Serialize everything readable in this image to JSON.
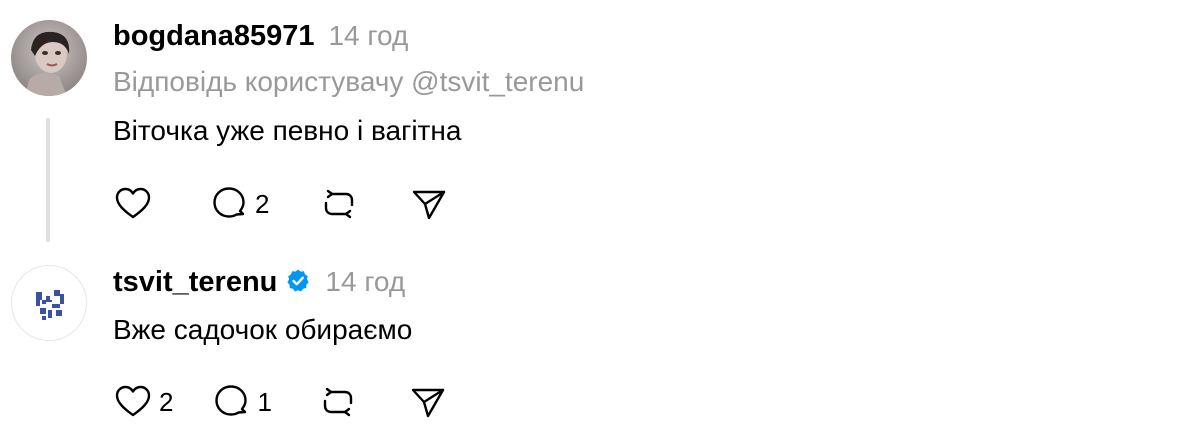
{
  "comments": [
    {
      "username": "bogdana85971",
      "time": "14 год",
      "reply_to": "Відповідь користувачу @tsvit_terenu",
      "text": "Віточка уже певно і вагітна",
      "verified": false,
      "likes": "",
      "replies": "2"
    },
    {
      "username": "tsvit_terenu",
      "time": "14 год",
      "text": "Вже садочок обираємо",
      "verified": true,
      "likes": "2",
      "replies": "1"
    }
  ],
  "icons": {
    "like": "heart-icon",
    "reply": "comment-bubble-icon",
    "repost": "repost-icon",
    "share": "send-icon",
    "verified": "verified-badge-icon"
  },
  "colors": {
    "verified": "#0095f6",
    "muted": "#999999",
    "thread_line": "#e0e0e0"
  }
}
